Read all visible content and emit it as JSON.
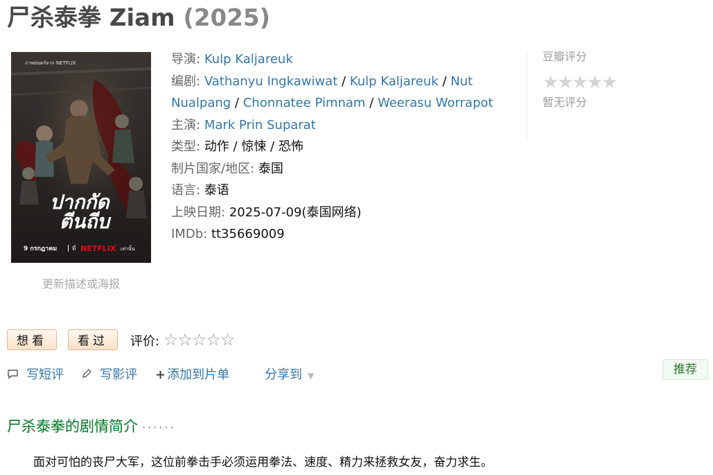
{
  "title": {
    "main": "尸杀泰拳 Ziam",
    "year": "(2025)"
  },
  "poster": {
    "top_text": "ภาพยนตร์จาก NETFLIX",
    "thai_title_line1": "ปากกัด",
    "thai_title_line2": "ตีนถีบ",
    "bottom_date": "9 กรกฎาคม",
    "bottom_at": "ที่",
    "bottom_brand": "NETFLIX",
    "bottom_only": "เท่านั้น"
  },
  "update_link": "更新描述或海报",
  "info": {
    "director_label": "导演",
    "director": "Kulp Kaljareuk",
    "writer_label": "编剧",
    "writers": [
      "Vathanyu Ingkawiwat",
      "Kulp Kaljareuk",
      "Nut Nualpang",
      "Chonnatee Pimnam",
      "Weerasu Worrapot"
    ],
    "cast_label": "主演",
    "cast": "Mark Prin Suparat",
    "genre_label": "类型",
    "genres": "动作 / 惊悚 / 恐怖",
    "country_label": "制片国家/地区",
    "country": "泰国",
    "language_label": "语言",
    "language": "泰语",
    "release_label": "上映日期",
    "release": "2025-07-09(泰国网络)",
    "imdb_label": "IMDb",
    "imdb": "tt35669009",
    "colon": ":",
    "separator": " / "
  },
  "rating": {
    "label": "豆瓣评分",
    "stars": "★★★★★",
    "none_text": "暂无评分"
  },
  "buttons": {
    "want": "想看",
    "watched": "看过"
  },
  "rate": {
    "label": "评价:",
    "star": "☆"
  },
  "actions": {
    "short_review": "写短评",
    "review": "写影评",
    "add_list": "添加到片单",
    "share": "分享到",
    "recommend": "推荐"
  },
  "synopsis": {
    "title": "尸杀泰拳的剧情简介",
    "dots": "······",
    "text": "面对可怕的丧尸大军，这位前拳击手必须运用拳法、速度、精力来拯救女友，奋力求生。"
  },
  "colors": {
    "link": "#3377aa",
    "green_heading": "#007722",
    "button_border": "#e3b58f"
  }
}
